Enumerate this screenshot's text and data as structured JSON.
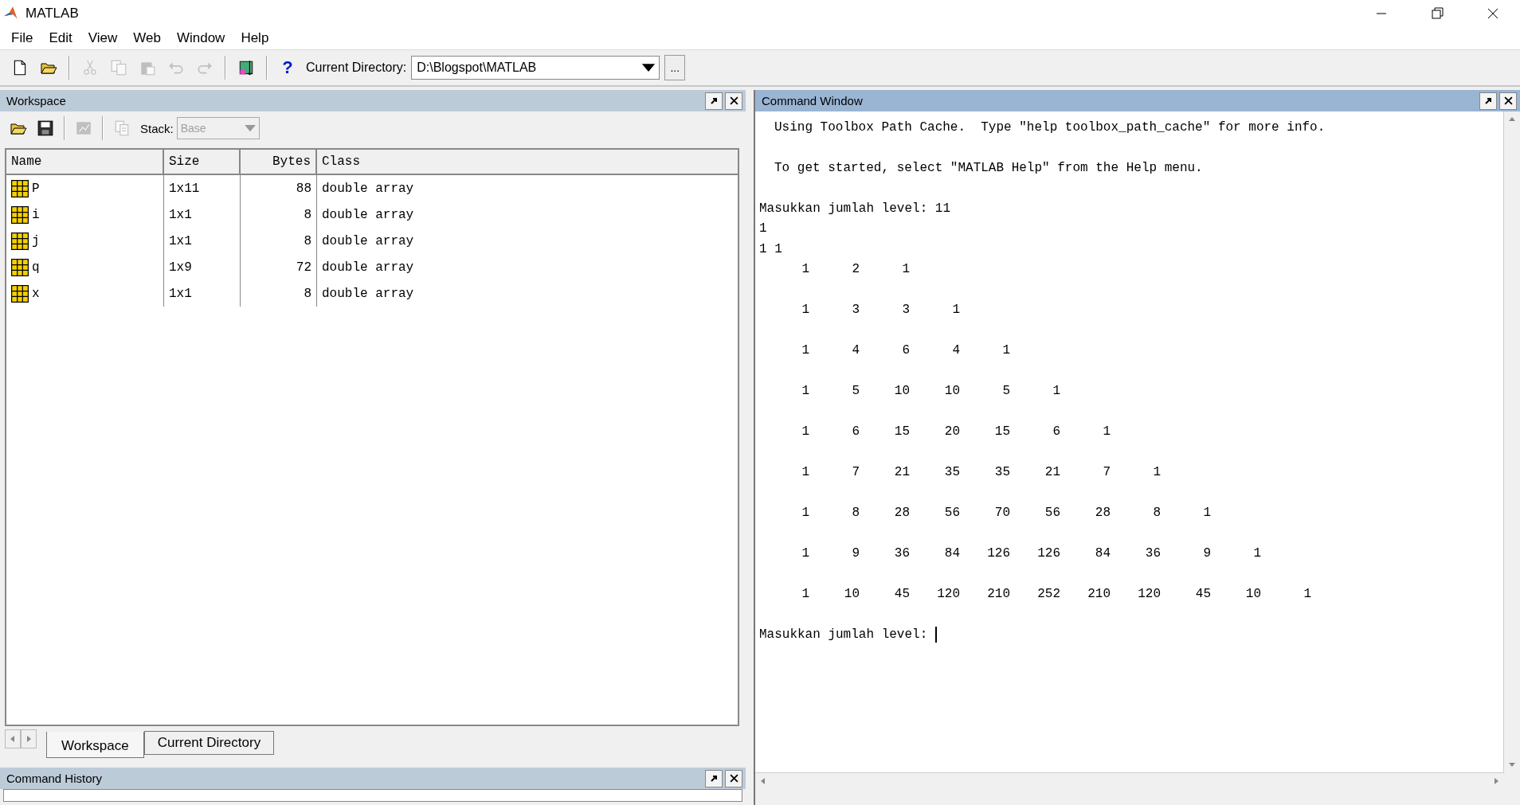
{
  "window": {
    "title": "MATLAB"
  },
  "menu": [
    "File",
    "Edit",
    "View",
    "Web",
    "Window",
    "Help"
  ],
  "toolbar": [
    {
      "kind": "new",
      "disabled": false
    },
    {
      "kind": "open",
      "disabled": false
    },
    {
      "kind": "sep"
    },
    {
      "kind": "cut",
      "disabled": true
    },
    {
      "kind": "copy",
      "disabled": true
    },
    {
      "kind": "paste",
      "disabled": true
    },
    {
      "kind": "undo",
      "disabled": true
    },
    {
      "kind": "redo",
      "disabled": true
    },
    {
      "kind": "sep"
    },
    {
      "kind": "simulink",
      "disabled": false
    },
    {
      "kind": "sep"
    },
    {
      "kind": "help",
      "label": "?",
      "disabled": false
    }
  ],
  "current_directory": {
    "label": "Current Directory:",
    "value": "D:\\Blogspot\\MATLAB",
    "browse": "..."
  },
  "workspace": {
    "title": "Workspace",
    "toolbar": [
      {
        "kind": "open",
        "disabled": false
      },
      {
        "kind": "save",
        "disabled": false
      },
      {
        "kind": "sep"
      },
      {
        "kind": "plot",
        "disabled": true
      },
      {
        "kind": "sep"
      },
      {
        "kind": "delete",
        "disabled": true
      }
    ],
    "stack": {
      "label": "Stack:",
      "value": "Base",
      "disabled": true
    },
    "columns": [
      "Name",
      "Size",
      "Bytes",
      "Class"
    ],
    "rows": [
      {
        "name": "P",
        "size": "1x11",
        "bytes": "88",
        "class": "double array"
      },
      {
        "name": "i",
        "size": "1x1",
        "bytes": "8",
        "class": "double array"
      },
      {
        "name": "j",
        "size": "1x1",
        "bytes": "8",
        "class": "double array"
      },
      {
        "name": "q",
        "size": "1x9",
        "bytes": "72",
        "class": "double array"
      },
      {
        "name": "x",
        "size": "1x1",
        "bytes": "8",
        "class": "double array"
      }
    ],
    "tabs": [
      {
        "label": "Workspace",
        "selected": true
      },
      {
        "label": "Current Directory",
        "selected": false
      }
    ]
  },
  "command_history": {
    "title": "Command History"
  },
  "command_window": {
    "title": "Command Window",
    "lines": [
      {
        "kind": "info",
        "text": "Using Toolbox Path Cache.  Type \"help toolbox_path_cache\" for more info."
      },
      {
        "kind": "blank"
      },
      {
        "kind": "info",
        "text": "To get started, select \"MATLAB Help\" from the Help menu."
      },
      {
        "kind": "blank"
      },
      {
        "kind": "text",
        "text": "Masukkan jumlah level: 11"
      },
      {
        "kind": "text",
        "text": "1"
      },
      {
        "kind": "text",
        "text": "1 1"
      },
      {
        "kind": "row",
        "values": [
          "1",
          "2",
          "1"
        ]
      },
      {
        "kind": "blank"
      },
      {
        "kind": "row",
        "values": [
          "1",
          "3",
          "3",
          "1"
        ]
      },
      {
        "kind": "blank"
      },
      {
        "kind": "row",
        "values": [
          "1",
          "4",
          "6",
          "4",
          "1"
        ]
      },
      {
        "kind": "blank"
      },
      {
        "kind": "row",
        "values": [
          "1",
          "5",
          "10",
          "10",
          "5",
          "1"
        ]
      },
      {
        "kind": "blank"
      },
      {
        "kind": "row",
        "values": [
          "1",
          "6",
          "15",
          "20",
          "15",
          "6",
          "1"
        ]
      },
      {
        "kind": "blank"
      },
      {
        "kind": "row",
        "values": [
          "1",
          "7",
          "21",
          "35",
          "35",
          "21",
          "7",
          "1"
        ]
      },
      {
        "kind": "blank"
      },
      {
        "kind": "row",
        "values": [
          "1",
          "8",
          "28",
          "56",
          "70",
          "56",
          "28",
          "8",
          "1"
        ]
      },
      {
        "kind": "blank"
      },
      {
        "kind": "row",
        "values": [
          "1",
          "9",
          "36",
          "84",
          "126",
          "126",
          "84",
          "36",
          "9",
          "1"
        ]
      },
      {
        "kind": "blank"
      },
      {
        "kind": "row",
        "values": [
          "1",
          "10",
          "45",
          "120",
          "210",
          "252",
          "210",
          "120",
          "45",
          "10",
          "1"
        ]
      },
      {
        "kind": "blank"
      },
      {
        "kind": "prompt",
        "text": "Masukkan jumlah level:"
      }
    ]
  }
}
